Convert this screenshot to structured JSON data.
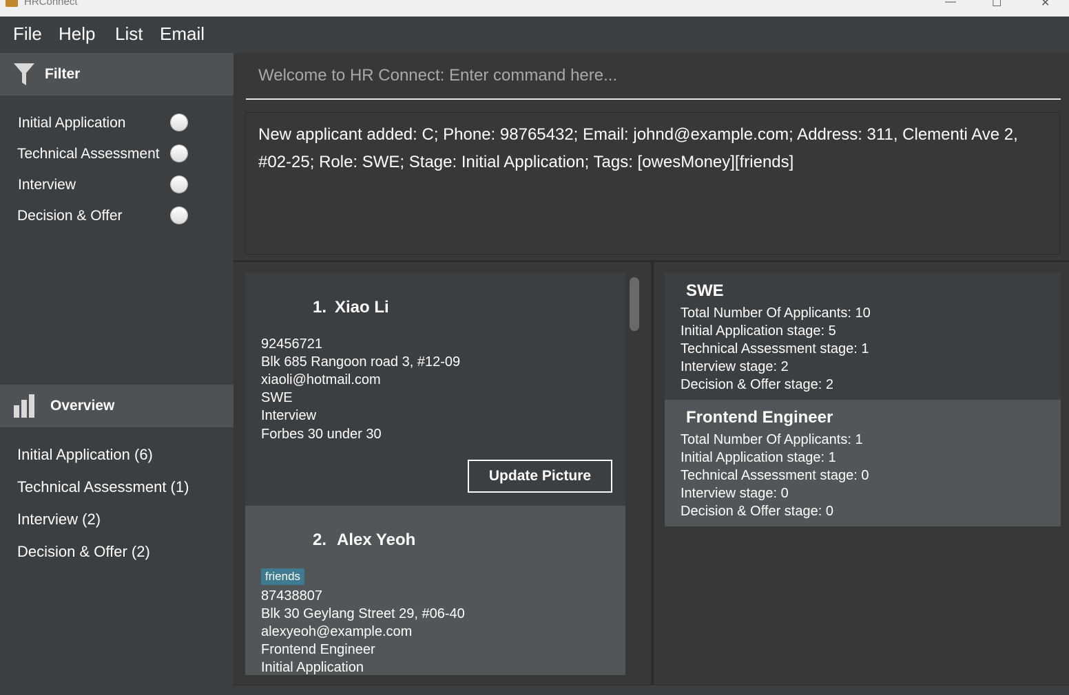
{
  "window": {
    "title": "HRConnect",
    "controls": [
      "—",
      "☐",
      "✕"
    ]
  },
  "menu": [
    "File",
    "Help",
    "List",
    "Email"
  ],
  "sidebar": {
    "filter": {
      "title": "Filter",
      "items": [
        {
          "label": "Initial Application"
        },
        {
          "label": "Technical Assessment"
        },
        {
          "label": "Interview"
        },
        {
          "label": "Decision & Offer"
        }
      ]
    },
    "overview": {
      "title": "Overview",
      "items": [
        {
          "label": "Initial Application (6)"
        },
        {
          "label": "Technical Assessment (1)"
        },
        {
          "label": "Interview (2)"
        },
        {
          "label": "Decision & Offer (2)"
        }
      ]
    }
  },
  "command": {
    "placeholder": "Welcome to HR Connect: Enter command here...",
    "value": ""
  },
  "result": {
    "text": "New applicant added: C; Phone: 98765432; Email: johnd@example.com; Address: 311, Clementi Ave 2, #02-25; Role: SWE; Stage: Initial Application; Tags: [owesMoney][friends]"
  },
  "applicants": [
    {
      "index": "1.",
      "name": "Xiao Li",
      "tags": [],
      "phone": "92456721",
      "address": "Blk 685 Rangoon road 3, #12-09",
      "email": "xiaoli@hotmail.com",
      "role": "SWE",
      "stage": "Interview",
      "note": "Forbes 30 under 30",
      "button": "Update Picture"
    },
    {
      "index": "2.",
      "name": "Alex Yeoh",
      "tags": [
        "friends"
      ],
      "phone": "87438807",
      "address": "Blk 30 Geylang Street 29, #06-40",
      "email": "alexyeoh@example.com",
      "role": "Frontend Engineer",
      "stage": "Initial Application"
    }
  ],
  "roles": [
    {
      "title": "SWE",
      "lines": [
        "Total Number Of Applicants: 10",
        "Initial Application stage: 5",
        "Technical Assessment stage: 1",
        "Interview stage: 2",
        "Decision & Offer stage: 2"
      ]
    },
    {
      "title": "Frontend Engineer",
      "lines": [
        "Total Number Of Applicants: 1",
        "Initial Application stage: 1",
        "Technical Assessment stage: 0",
        "Interview stage: 0",
        "Decision & Offer stage: 0"
      ]
    }
  ],
  "colors": {
    "background": "#3c3f41",
    "card_dark": "#3c3f41",
    "card_light": "#515658",
    "tag": "#3e7b91",
    "header": "#4f5254"
  },
  "icons": {
    "filter": "filter-funnel-icon",
    "overview": "bar-chart-icon"
  }
}
